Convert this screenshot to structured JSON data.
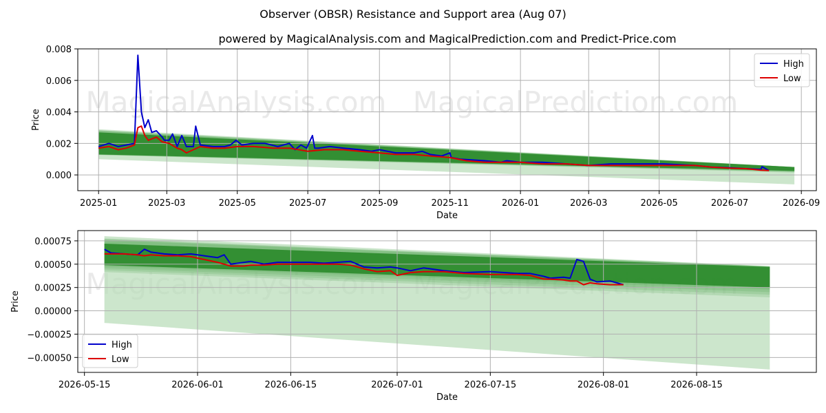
{
  "chart_title": "Observer (OBSR) Resistance and Support area (Aug 07)",
  "chart_subtitle": "powered by MagicalAnalysis.com and MagicalPrediction.com and Predict-Price.com",
  "watermarks": [
    "MagicalAnalysis.com",
    "MagicalPrediction.com"
  ],
  "colors": {
    "high": "#0000cc",
    "low": "#dd0000",
    "band_dark": "#2a8a2a",
    "band_light": "#b6dcb6",
    "grid": "#b0b0b0"
  },
  "chart_data": [
    {
      "type": "line",
      "xlabel": "Date",
      "ylabel": "Price",
      "xlim": [
        "2024-12-14",
        "2026-09-14"
      ],
      "ylim": [
        -0.001,
        0.008
      ],
      "x_ticks": [
        "2025-01",
        "2025-03",
        "2025-05",
        "2025-07",
        "2025-09",
        "2025-11",
        "2026-01",
        "2026-03",
        "2026-05",
        "2026-07",
        "2026-09"
      ],
      "y_ticks": [
        "0.000",
        "0.002",
        "0.004",
        "0.006",
        "0.008"
      ],
      "legend": {
        "position": "top-right",
        "entries": [
          "High",
          "Low"
        ]
      },
      "grid": true,
      "series": [
        {
          "name": "High",
          "x": [
            "2025-01-01",
            "2025-01-10",
            "2025-01-18",
            "2025-01-25",
            "2025-02-01",
            "2025-02-04",
            "2025-02-07",
            "2025-02-10",
            "2025-02-13",
            "2025-02-16",
            "2025-02-20",
            "2025-02-25",
            "2025-02-27",
            "2025-03-03",
            "2025-03-06",
            "2025-03-10",
            "2025-03-14",
            "2025-03-18",
            "2025-03-24",
            "2025-03-26",
            "2025-03-30",
            "2025-04-10",
            "2025-04-20",
            "2025-04-25",
            "2025-04-30",
            "2025-05-05",
            "2025-05-15",
            "2025-05-25",
            "2025-06-05",
            "2025-06-15",
            "2025-06-20",
            "2025-06-25",
            "2025-06-30",
            "2025-07-05",
            "2025-07-07",
            "2025-07-10",
            "2025-07-20",
            "2025-08-01",
            "2025-08-15",
            "2025-08-25",
            "2025-09-01",
            "2025-09-15",
            "2025-10-01",
            "2025-10-08",
            "2025-10-15",
            "2025-10-25",
            "2025-11-01",
            "2025-11-02",
            "2025-11-10",
            "2025-12-01",
            "2025-12-15",
            "2025-12-20",
            "2026-01-01",
            "2026-01-20",
            "2026-02-10",
            "2026-03-01",
            "2026-03-20",
            "2026-04-01",
            "2026-04-20",
            "2026-05-05",
            "2026-05-18",
            "2026-06-01",
            "2026-06-15",
            "2026-07-01",
            "2026-07-15",
            "2026-07-28",
            "2026-07-29",
            "2026-08-04"
          ],
          "values": [
            0.0018,
            0.002,
            0.0018,
            0.0019,
            0.002,
            0.0076,
            0.004,
            0.003,
            0.0035,
            0.0027,
            0.0028,
            0.0024,
            0.0022,
            0.0022,
            0.0026,
            0.0018,
            0.0025,
            0.0018,
            0.0018,
            0.0031,
            0.0019,
            0.0018,
            0.0018,
            0.0019,
            0.0022,
            0.0019,
            0.002,
            0.002,
            0.0018,
            0.002,
            0.0016,
            0.0019,
            0.0017,
            0.0025,
            0.0017,
            0.0017,
            0.0018,
            0.0017,
            0.0016,
            0.0015,
            0.0016,
            0.0014,
            0.0014,
            0.0015,
            0.0013,
            0.0012,
            0.0014,
            0.0011,
            0.001,
            0.0009,
            0.0008,
            0.0009,
            0.0008,
            0.0008,
            0.0007,
            0.0006,
            0.0007,
            0.0007,
            0.0007,
            0.0007,
            0.00065,
            0.0006,
            0.0005,
            0.00045,
            0.0004,
            0.00035,
            0.00052,
            0.00028
          ]
        },
        {
          "name": "Low",
          "x": [
            "2025-01-01",
            "2025-01-10",
            "2025-01-18",
            "2025-01-25",
            "2025-02-01",
            "2025-02-04",
            "2025-02-07",
            "2025-02-10",
            "2025-02-13",
            "2025-02-20",
            "2025-02-25",
            "2025-03-03",
            "2025-03-10",
            "2025-03-14",
            "2025-03-18",
            "2025-03-24",
            "2025-03-30",
            "2025-04-10",
            "2025-04-20",
            "2025-05-01",
            "2025-05-15",
            "2025-06-01",
            "2025-06-15",
            "2025-07-01",
            "2025-07-15",
            "2025-08-01",
            "2025-08-15",
            "2025-09-01",
            "2025-09-15",
            "2025-10-01",
            "2025-10-15",
            "2025-11-01",
            "2025-11-15",
            "2025-12-01",
            "2025-12-15",
            "2026-01-01",
            "2026-01-20",
            "2026-02-10",
            "2026-03-01",
            "2026-03-20",
            "2026-04-01",
            "2026-04-20",
            "2026-05-05",
            "2026-05-18",
            "2026-06-01",
            "2026-06-15",
            "2026-07-01",
            "2026-07-15",
            "2026-07-28",
            "2026-08-04"
          ],
          "values": [
            0.0017,
            0.0018,
            0.0016,
            0.0017,
            0.0019,
            0.003,
            0.0031,
            0.0025,
            0.0022,
            0.0024,
            0.0021,
            0.002,
            0.0017,
            0.0016,
            0.0014,
            0.0016,
            0.0018,
            0.0017,
            0.0017,
            0.0018,
            0.0018,
            0.0017,
            0.0017,
            0.0015,
            0.0016,
            0.0016,
            0.0015,
            0.0014,
            0.0013,
            0.0013,
            0.0012,
            0.0011,
            0.0009,
            0.0008,
            0.0008,
            0.0008,
            0.0007,
            0.0007,
            0.0006,
            0.0006,
            0.0006,
            0.0006,
            0.0006,
            0.0006,
            0.0006,
            0.0005,
            0.00043,
            0.0004,
            0.0003,
            0.00028
          ]
        }
      ],
      "band": {
        "x": [
          "2025-01-01",
          "2026-08-26"
        ],
        "dark_upper": [
          0.0027,
          0.0005
        ],
        "dark_lower": [
          0.0013,
          0.00025
        ],
        "light_upper": [
          0.0029,
          0.0005
        ],
        "light_lower": [
          0.001,
          -0.0006
        ]
      }
    },
    {
      "type": "line",
      "xlabel": "Date",
      "ylabel": "Price",
      "xlim": [
        "2026-05-14",
        "2026-09-02"
      ],
      "ylim": [
        -0.00066,
        0.00086
      ],
      "x_ticks": [
        "2026-05-15",
        "2026-06-01",
        "2026-06-15",
        "2026-07-01",
        "2026-07-15",
        "2026-08-01",
        "2026-08-15"
      ],
      "y_ticks": [
        "−0.00050",
        "−0.00025",
        "0.00000",
        "0.00025",
        "0.00050",
        "0.00075"
      ],
      "legend": {
        "position": "bottom-left",
        "entries": [
          "High",
          "Low"
        ]
      },
      "grid": true,
      "series": [
        {
          "name": "High",
          "x": [
            "2026-05-18",
            "2026-05-19",
            "2026-05-21",
            "2026-05-23",
            "2026-05-24",
            "2026-05-25",
            "2026-05-27",
            "2026-05-29",
            "2026-05-31",
            "2026-06-02",
            "2026-06-04",
            "2026-06-05",
            "2026-06-06",
            "2026-06-08",
            "2026-06-09",
            "2026-06-11",
            "2026-06-13",
            "2026-06-15",
            "2026-06-18",
            "2026-06-20",
            "2026-06-22",
            "2026-06-24",
            "2026-06-26",
            "2026-06-28",
            "2026-06-30",
            "2026-07-01",
            "2026-07-03",
            "2026-07-05",
            "2026-07-08",
            "2026-07-11",
            "2026-07-15",
            "2026-07-19",
            "2026-07-21",
            "2026-07-23",
            "2026-07-24",
            "2026-07-26",
            "2026-07-27",
            "2026-07-28",
            "2026-07-29",
            "2026-07-30",
            "2026-07-31",
            "2026-08-02",
            "2026-08-04"
          ],
          "values": [
            0.00066,
            0.00062,
            0.00061,
            0.0006,
            0.00066,
            0.00063,
            0.00061,
            0.0006,
            0.00061,
            0.00059,
            0.00057,
            0.0006,
            0.0005,
            0.00052,
            0.00053,
            0.0005,
            0.00052,
            0.00052,
            0.00052,
            0.00051,
            0.00052,
            0.00053,
            0.00047,
            0.00046,
            0.00047,
            0.00046,
            0.00043,
            0.00046,
            0.00043,
            0.00041,
            0.00042,
            0.0004,
            0.0004,
            0.00037,
            0.00035,
            0.00036,
            0.00035,
            0.00055,
            0.00053,
            0.00034,
            0.00031,
            0.00032,
            0.00028
          ]
        },
        {
          "name": "Low",
          "x": [
            "2026-05-18",
            "2026-05-19",
            "2026-05-21",
            "2026-05-23",
            "2026-05-24",
            "2026-05-25",
            "2026-05-27",
            "2026-05-29",
            "2026-05-31",
            "2026-06-02",
            "2026-06-04",
            "2026-06-05",
            "2026-06-06",
            "2026-06-08",
            "2026-06-09",
            "2026-06-11",
            "2026-06-13",
            "2026-06-15",
            "2026-06-18",
            "2026-06-20",
            "2026-06-22",
            "2026-06-24",
            "2026-06-26",
            "2026-06-28",
            "2026-06-30",
            "2026-07-01",
            "2026-07-03",
            "2026-07-05",
            "2026-07-08",
            "2026-07-11",
            "2026-07-15",
            "2026-07-19",
            "2026-07-21",
            "2026-07-23",
            "2026-07-24",
            "2026-07-26",
            "2026-07-27",
            "2026-07-28",
            "2026-07-29",
            "2026-07-30",
            "2026-07-31",
            "2026-08-02",
            "2026-08-04"
          ],
          "values": [
            0.00061,
            0.00061,
            0.00061,
            0.0006,
            0.00059,
            0.0006,
            0.00059,
            0.00059,
            0.00058,
            0.00055,
            0.00052,
            0.0005,
            0.00048,
            0.00048,
            0.00049,
            0.00049,
            0.0005,
            0.0005,
            0.0005,
            0.0005,
            0.0005,
            0.00049,
            0.00045,
            0.00042,
            0.00043,
            0.00038,
            0.00041,
            0.00042,
            0.00042,
            0.0004,
            0.00039,
            0.00039,
            0.00038,
            0.00034,
            0.00034,
            0.00033,
            0.00032,
            0.00032,
            0.00028,
            0.0003,
            0.00029,
            0.00028,
            0.00028
          ]
        }
      ],
      "band": {
        "x": [
          "2026-05-18",
          "2026-08-26"
        ],
        "dark_upper": [
          0.00072,
          0.00047
        ],
        "dark_lower": [
          0.00049,
          0.00025
        ],
        "light_upper": [
          0.0008,
          0.00048
        ],
        "light_lower": [
          -0.00013,
          -0.00063
        ]
      }
    }
  ]
}
